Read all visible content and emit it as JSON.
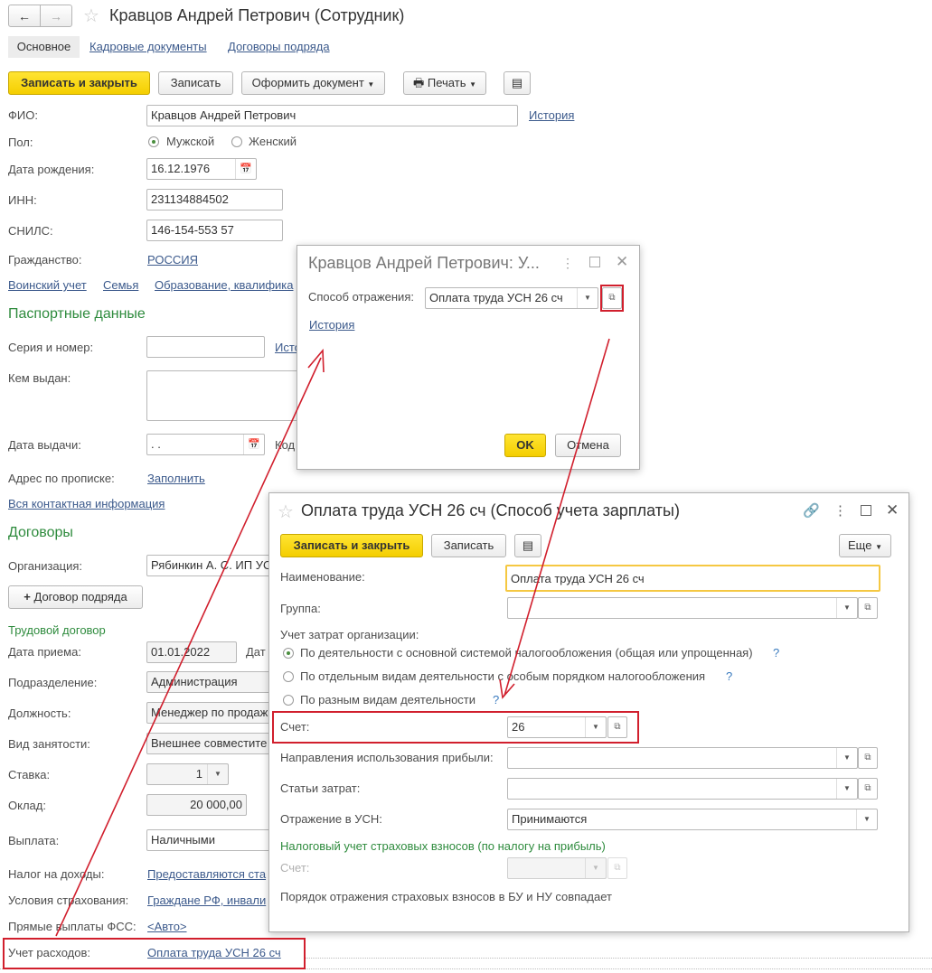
{
  "window": {
    "title": "Кравцов Андрей Петрович (Сотрудник)",
    "tabs": [
      "Основное",
      "Кадровые документы",
      "Договоры подряда"
    ]
  },
  "toolbar": {
    "save_close": "Записать и закрыть",
    "save": "Записать",
    "make_doc": "Оформить документ",
    "print": "Печать"
  },
  "form": {
    "fio_label": "ФИО:",
    "fio_value": "Кравцов Андрей Петрович",
    "history": "История",
    "gender_label": "Пол:",
    "male": "Мужской",
    "female": "Женский",
    "birth_label": "Дата рождения:",
    "birth_value": "16.12.1976",
    "inn_label": "ИНН:",
    "inn_value": "231134884502",
    "snils_label": "СНИЛС:",
    "snils_value": "146-154-553 57",
    "citizen_label": "Гражданство:",
    "citizen_value": "РОССИЯ",
    "links": [
      "Воинский учет",
      "Семья",
      "Образование, квалифика"
    ],
    "passport_header": "Паспортные данные",
    "series_label": "Серия и номер:",
    "series_link": "Исто",
    "issued_label": "Кем выдан:",
    "issue_date_label": "Дата выдачи:",
    "issue_date_value": " .  .",
    "code_label": "Код",
    "address_label": "Адрес по прописке:",
    "address_link": "Заполнить",
    "contact_link": "Вся контактная информация",
    "contracts_header": "Договоры",
    "org_label": "Организация:",
    "org_value": "Рябинкин А. С. ИП УС",
    "add_contract": "Договор подряда",
    "labor_header": "Трудовой договор",
    "hire_label": "Дата приема:",
    "hire_value": "01.01.2022",
    "hire_extra": "Дат",
    "dept_label": "Подразделение:",
    "dept_value": "Администрация",
    "position_label": "Должность:",
    "position_value": "Менеджер по продаж",
    "employment_label": "Вид занятости:",
    "employment_value": "Внешнее совместите",
    "rate_label": "Ставка:",
    "rate_value": "1",
    "salary_label": "Оклад:",
    "salary_value": "20 000,00",
    "payment_label": "Выплата:",
    "payment_value": "Наличными",
    "tax_label": "Налог на доходы:",
    "tax_link": "Предоставляются ста",
    "insurance_label": "Условия страхования:",
    "insurance_link": "Граждане РФ, инвали",
    "fss_label": "Прямые выплаты ФСС:",
    "fss_link": "<Авто>",
    "expense_label": "Учет расходов:",
    "expense_link": "Оплата труда УСН 26 сч"
  },
  "dialog1": {
    "title": "Кравцов Андрей Петрович: У...",
    "method_label": "Способ отражения:",
    "method_value": "Оплата труда УСН 26 сч",
    "history": "История",
    "ok": "OK",
    "cancel": "Отмена"
  },
  "dialog2": {
    "title": "Оплата труда УСН 26 сч (Способ учета зарплаты)",
    "save_close": "Записать и закрыть",
    "save": "Записать",
    "more": "Еще",
    "name_label": "Наименование:",
    "name_value": "Оплата труда УСН 26 сч",
    "group_label": "Группа:",
    "costs_label": "Учет затрат организации:",
    "opt1": "По деятельности с основной системой налогообложения (общая или упрощенная)",
    "opt2": "По отдельным видам деятельности с особым порядком налогообложения",
    "opt3": "По разным видам деятельности",
    "help": "?",
    "account_label": "Счет:",
    "account_value": "26",
    "profit_label": "Направления использования прибыли:",
    "cost_items_label": "Статьи затрат:",
    "usn_label": "Отражение в УСН:",
    "usn_value": "Принимаются",
    "tax_header": "Налоговый учет страховых взносов (по налогу на прибыль)",
    "account2_label": "Счет:",
    "note": "Порядок отражения страховых взносов в БУ и НУ совпадает"
  }
}
